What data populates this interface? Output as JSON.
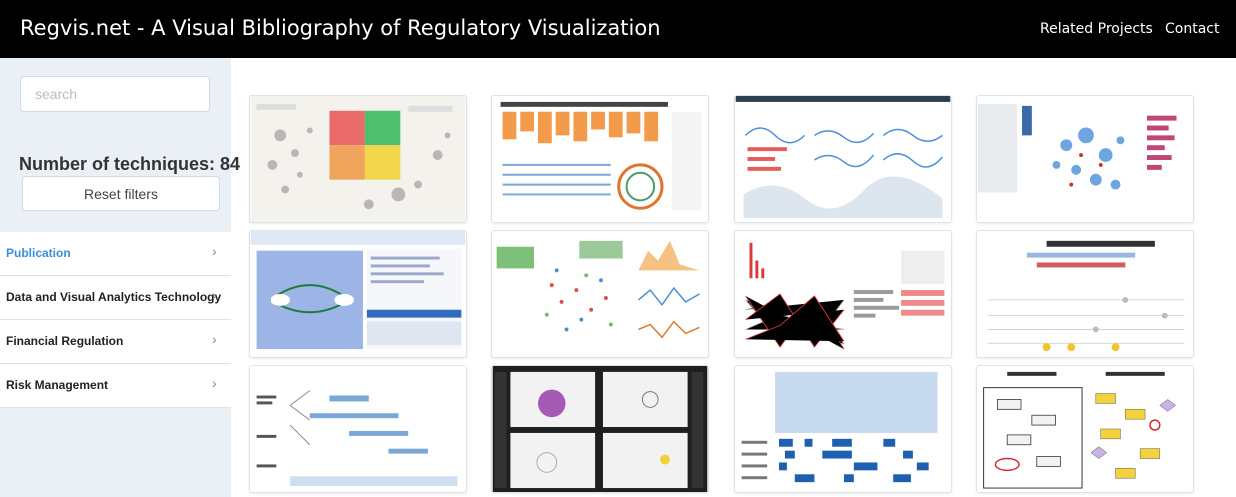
{
  "header": {
    "title": "Regvis.net - A Visual Bibliography of Regulatory Visualization",
    "nav": [
      "Related Projects",
      "Contact"
    ]
  },
  "sidebar": {
    "search_placeholder": "search",
    "count_label": "Number of techniques: 84",
    "reset_label": "Reset filters",
    "filters": [
      {
        "label": "Publication",
        "active": true
      },
      {
        "label": "Data and Visual Analytics Technology",
        "active": false
      },
      {
        "label": "Financial Regulation",
        "active": false
      },
      {
        "label": "Risk Management",
        "active": false
      }
    ]
  },
  "gallery": {
    "technique_thumbnails": [
      {
        "kind": "quadrant-map"
      },
      {
        "kind": "orange-dashboard"
      },
      {
        "kind": "small-multiples-lines"
      },
      {
        "kind": "blue-network"
      },
      {
        "kind": "blue-flow-editor"
      },
      {
        "kind": "scatter-timeseries"
      },
      {
        "kind": "bars-parallel-coordinates"
      },
      {
        "kind": "blockchain-timeline"
      },
      {
        "kind": "timeline-rows"
      },
      {
        "kind": "dark-node-panels"
      },
      {
        "kind": "blue-matrix"
      },
      {
        "kind": "process-flowcharts"
      }
    ]
  },
  "colors": {
    "header_bg": "#000000",
    "sidebar_bg": "#eaf0f5",
    "active_filter": "#3a8fd9"
  }
}
